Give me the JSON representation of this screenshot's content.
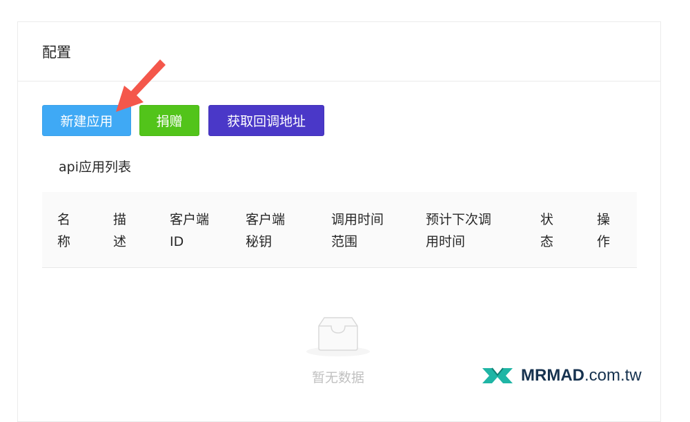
{
  "card": {
    "title": "配置"
  },
  "toolbar": {
    "new_app_label": "新建应用",
    "donate_label": "捐赠",
    "callback_label": "获取回调地址"
  },
  "list": {
    "title": "api应用列表"
  },
  "table": {
    "columns": [
      {
        "line1": "名",
        "line2": "称"
      },
      {
        "line1": "描",
        "line2": "述"
      },
      {
        "line1": "客户端",
        "line2": "ID"
      },
      {
        "line1": "客户端",
        "line2": "秘钥"
      },
      {
        "line1": "调用时间",
        "line2": "范围"
      },
      {
        "line1": "预计下次调",
        "line2": "用时间"
      },
      {
        "line1": "状",
        "line2": "态"
      },
      {
        "line1": "操",
        "line2": "作"
      }
    ],
    "empty_text": "暂无数据"
  },
  "watermark": {
    "brand": "MRMAD",
    "suffix": ".com.tw"
  },
  "colors": {
    "new_button": "#3fa9f5",
    "donate_button": "#52c41a",
    "callback_button": "#4a38c8",
    "arrow": "#f4574b",
    "logo_accent": "#1fb5a5"
  }
}
